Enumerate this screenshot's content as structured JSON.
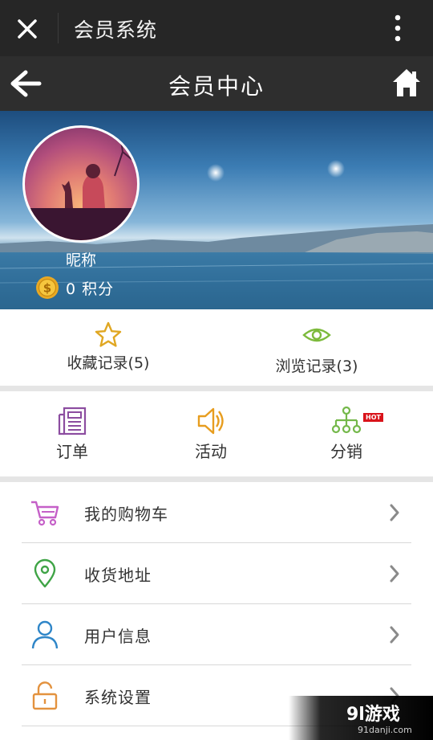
{
  "wechat_bar": {
    "title": "会员系统"
  },
  "header": {
    "title": "会员中心"
  },
  "profile": {
    "nickname": "昵称",
    "points": "0 积分"
  },
  "records": [
    {
      "label": "收藏记录(5)",
      "icon": "star-icon"
    },
    {
      "label": "浏览记录(3)",
      "icon": "eye-icon"
    }
  ],
  "actions": [
    {
      "label": "订单",
      "icon": "orders-icon"
    },
    {
      "label": "活动",
      "icon": "speaker-icon"
    },
    {
      "label": "分销",
      "icon": "distribution-icon",
      "badge": "HOT"
    }
  ],
  "menu": [
    {
      "label": "我的购物车",
      "icon": "cart-icon"
    },
    {
      "label": "收货地址",
      "icon": "location-pin-icon"
    },
    {
      "label": "用户信息",
      "icon": "user-icon"
    },
    {
      "label": "系统设置",
      "icon": "unlock-icon"
    }
  ],
  "watermark": {
    "logo": "9l游戏",
    "url": "91danji.com"
  },
  "colors": {
    "topbar": "#262626",
    "header": "#2e2e2e",
    "star": "#e0a722",
    "eye": "#7dba3c",
    "orders": "#8c4da0",
    "speaker": "#e79d1f",
    "distribution": "#74b84a",
    "cart": "#c560c8",
    "pin": "#3fa446",
    "user": "#2f86c8",
    "settings": "#e3923e",
    "hot": "#d9131a"
  }
}
